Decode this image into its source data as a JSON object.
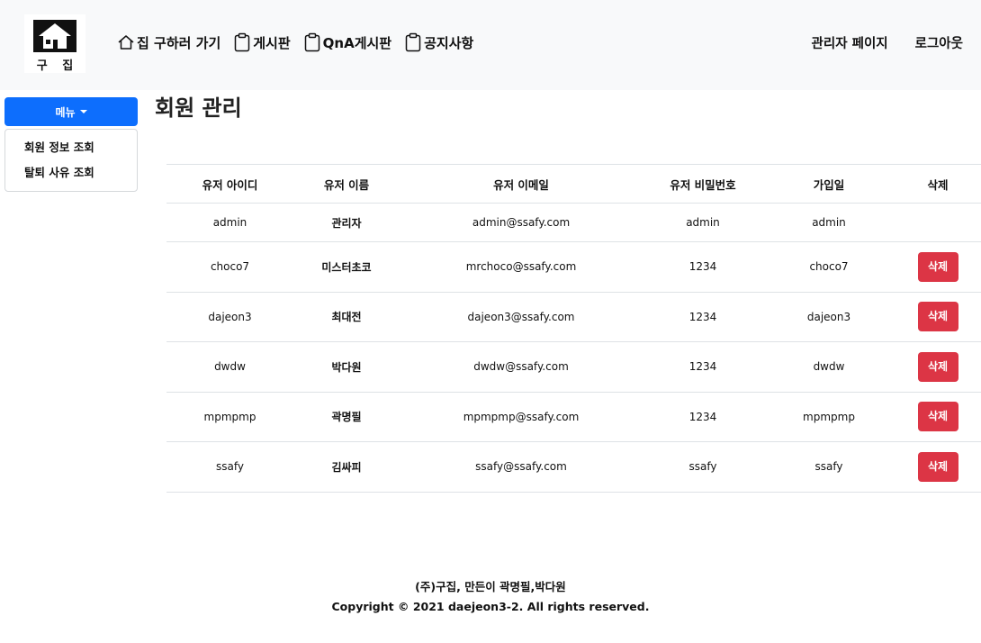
{
  "brand": {
    "logo_text": "구 집"
  },
  "nav": {
    "left": [
      {
        "label": "집 구하러 가기",
        "icon": "house-icon"
      },
      {
        "label": "게시판",
        "icon": "clipboard-icon"
      },
      {
        "label": "QnA게시판",
        "icon": "clipboard-icon"
      },
      {
        "label": "공지사항",
        "icon": "clipboard-icon"
      }
    ],
    "right": [
      {
        "label": "관리자 페이지"
      },
      {
        "label": "로그아웃"
      }
    ]
  },
  "sidebar": {
    "menu_label": "메뉴",
    "items": [
      {
        "label": "회원 정보 조회"
      },
      {
        "label": "탈퇴 사유 조회"
      }
    ]
  },
  "main": {
    "title": "회원 관리",
    "table": {
      "headers": [
        "유저 아이디",
        "유저 이름",
        "유저 이메일",
        "유저 비밀번호",
        "가입일",
        "삭제"
      ],
      "rows": [
        {
          "id": "admin",
          "name": "관리자",
          "email": "admin@ssafy.com",
          "password": "admin",
          "joined": "admin",
          "delete": ""
        },
        {
          "id": "choco7",
          "name": "미스터초코",
          "email": "mrchoco@ssafy.com",
          "password": "1234",
          "joined": "choco7",
          "delete": "삭제"
        },
        {
          "id": "dajeon3",
          "name": "최대전",
          "email": "dajeon3@ssafy.com",
          "password": "1234",
          "joined": "dajeon3",
          "delete": "삭제"
        },
        {
          "id": "dwdw",
          "name": "박다원",
          "email": "dwdw@ssafy.com",
          "password": "1234",
          "joined": "dwdw",
          "delete": "삭제"
        },
        {
          "id": "mpmpmp",
          "name": "곽명필",
          "email": "mpmpmp@ssafy.com",
          "password": "1234",
          "joined": "mpmpmp",
          "delete": "삭제"
        },
        {
          "id": "ssafy",
          "name": "김싸피",
          "email": "ssafy@ssafy.com",
          "password": "ssafy",
          "joined": "ssafy",
          "delete": "삭제"
        }
      ]
    }
  },
  "footer": {
    "line1": "(주)구집, 만든이 곽명필,박다원",
    "line2": "Copyright © 2021 daejeon3-2. All rights reserved."
  },
  "colors": {
    "primary": "#0d6efd",
    "danger": "#dc3545",
    "navbar_bg": "#f8f9fa"
  }
}
